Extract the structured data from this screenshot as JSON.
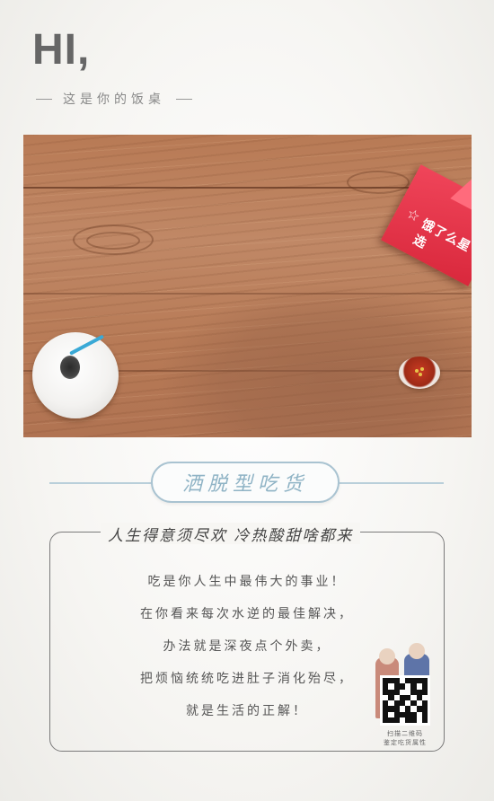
{
  "header": {
    "greeting": "HI,",
    "subtitle": "这是你的饭桌"
  },
  "photo": {
    "bag_brand": "饿了么星选",
    "bag_star": "☆"
  },
  "badge": {
    "label": "洒脱型吃货"
  },
  "card": {
    "heading": "人生得意须尽欢 冷热酸甜啥都来",
    "lines": [
      "吃是你人生中最伟大的事业！",
      "在你看来每次水逆的最佳解决，",
      "办法就是深夜点个外卖，",
      "把烦恼统统吃进肚子消化殆尽，",
      "就是生活的正解！"
    ]
  },
  "qr": {
    "caption_line1": "扫描二维码",
    "caption_line2": "鉴定吃货属性"
  },
  "colors": {
    "badge_text": "#8fb3c5",
    "badge_border": "#a9c3d1",
    "wood": "#b87a55",
    "bag_red": "#e83349"
  }
}
